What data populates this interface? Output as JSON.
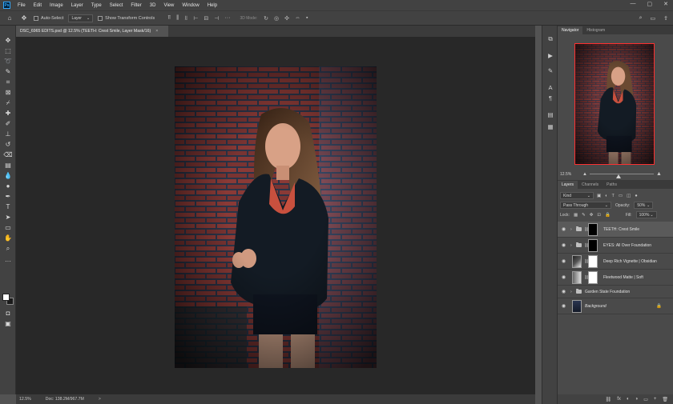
{
  "menu": [
    "File",
    "Edit",
    "Image",
    "Layer",
    "Type",
    "Select",
    "Filter",
    "3D",
    "View",
    "Window",
    "Help"
  ],
  "app_logo": "Ps",
  "window_controls": [
    "—",
    "▢",
    "✕"
  ],
  "options_bar": {
    "auto_select_label": "Auto-Select",
    "auto_select_target": "Layer",
    "transform_controls_label": "Show Transform Controls",
    "mode_3d_label": "3D Mode:"
  },
  "document_tab": {
    "title": "DSC_6965 EDITS.psd @ 12.5% (TEETH: Crest Smile, Layer Mask/16)",
    "close": "×"
  },
  "status_bar": {
    "zoom": "12.5%",
    "doc_info": "Doc: 138.2M/967.7M",
    "arrow": ">"
  },
  "navigator": {
    "tabs": [
      "Navigator",
      "Histogram"
    ],
    "zoom_label": "12.5%",
    "zoom_fraction": 0.45
  },
  "layers_panel": {
    "tabs": [
      "Layers",
      "Channels",
      "Paths"
    ],
    "filter_label": "Kind",
    "blend_mode": "Pass Through",
    "opacity_label": "Opacity:",
    "opacity_value": "50%",
    "lock_label": "Lock:",
    "fill_label": "Fill:",
    "fill_value": "100%",
    "layers": [
      {
        "name": "TEETH: Crest Smile",
        "type": "group"
      },
      {
        "name": "EYES: All Over Foundation",
        "type": "group"
      },
      {
        "name": "Deep Rich Vignette | Obsidian",
        "type": "adjustment"
      },
      {
        "name": "Fleetwood Matte | Soft",
        "type": "adjustment"
      },
      {
        "name": "Garden State Foundation",
        "type": "group-empty"
      },
      {
        "name": "Background",
        "type": "background"
      }
    ],
    "footer_icons": [
      "⛓",
      "fx",
      "◐",
      "◑",
      "▭",
      "+",
      "🗑"
    ]
  }
}
